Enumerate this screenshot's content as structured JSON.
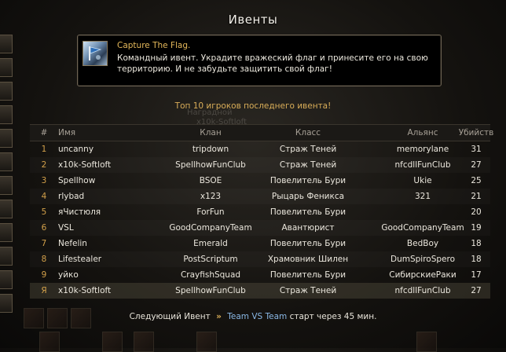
{
  "window": {
    "title": "Ивенты"
  },
  "event": {
    "icon": "capture-flag-icon",
    "name": "Capture The Flag.",
    "description": " Командный ивент. Украдите вражеский флаг и принесите его на свою\nтерриторию. И не забудьте защитить свой флаг!"
  },
  "top_caption": "Топ 10 игроков последнего ивента!",
  "background_ghost": {
    "line1": "Наградной",
    "line2": "x10k-Softloft"
  },
  "table": {
    "headers": {
      "num": "#",
      "name": "Имя",
      "clan": "Клан",
      "class": "Класс",
      "ally": "Альянс",
      "kills": "Убийств"
    },
    "rows": [
      {
        "num": "1",
        "name": "uncanny",
        "clan": "tripdown",
        "class": "Страж Теней",
        "ally": "memorylane",
        "kills": "31"
      },
      {
        "num": "2",
        "name": "x10k-Softloft",
        "clan": "SpellhowFunClub",
        "class": "Страж Теней",
        "ally": "nfcdllFunClub",
        "kills": "27"
      },
      {
        "num": "3",
        "name": "Spellhow",
        "clan": "BSOE",
        "class": "Повелитель Бури",
        "ally": "Ukie",
        "kills": "25"
      },
      {
        "num": "4",
        "name": "rlybad",
        "clan": "x123",
        "class": "Рыцарь Феникса",
        "ally": "321",
        "kills": "21"
      },
      {
        "num": "5",
        "name": "яЧистюля",
        "clan": "ForFun",
        "class": "Повелитель Бури",
        "ally": "",
        "kills": "20"
      },
      {
        "num": "6",
        "name": "VSL",
        "clan": "GoodCompanyTeam",
        "class": "Авантюрист",
        "ally": "GoodCompanyTeam",
        "kills": "19"
      },
      {
        "num": "7",
        "name": "Nefelin",
        "clan": "Emerald",
        "class": "Повелитель Бури",
        "ally": "BedBoy",
        "kills": "18"
      },
      {
        "num": "8",
        "name": "Lifestealer",
        "clan": "PostScriptum",
        "class": "Храмовник Шилен",
        "ally": "DumSpiroSpero",
        "kills": "18"
      },
      {
        "num": "9",
        "name": "уйко",
        "clan": "CrayfishSquad",
        "class": "Повелитель Бури",
        "ally": "СибирскиеРаки",
        "kills": "17"
      },
      {
        "num": "Я",
        "name": "x10k-Softloft",
        "clan": "SpellhowFunClub",
        "class": "Страж Теней",
        "ally": "nfcdllFunClub",
        "kills": "27"
      }
    ]
  },
  "footer": {
    "prefix": "Следующий Ивент",
    "arrow": "»",
    "event_name": "Team VS Team",
    "suffix": "старт через 45 мин."
  },
  "colors": {
    "accent_gold": "#d9ad58",
    "event_blue": "#8ab8e6",
    "panel_bg": "#000000"
  }
}
